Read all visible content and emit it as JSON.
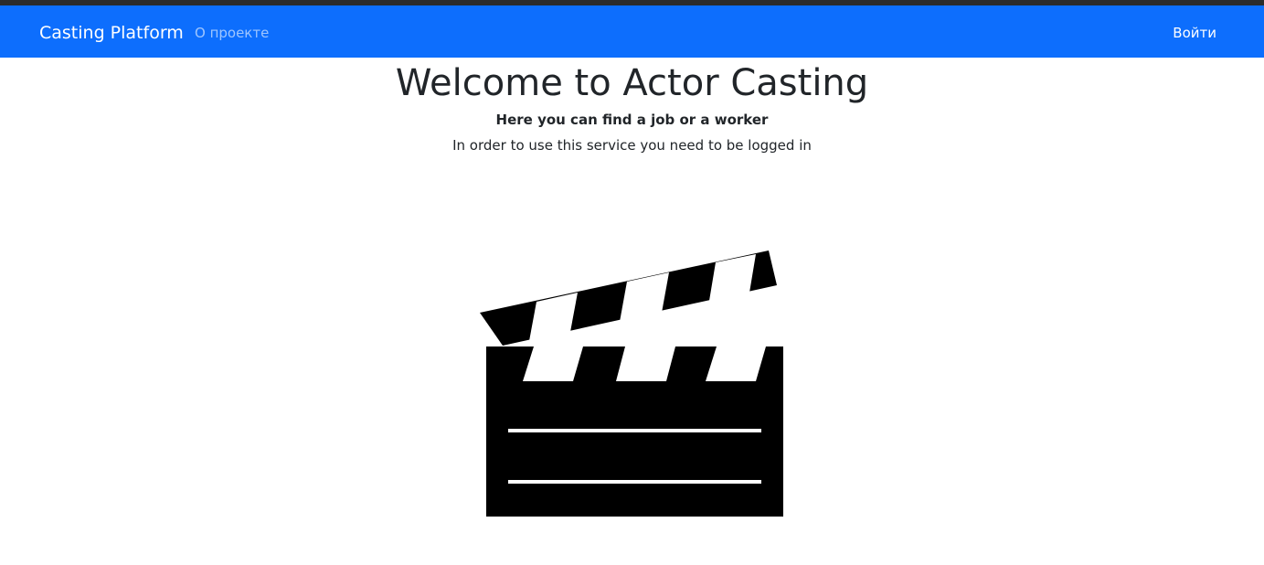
{
  "navbar": {
    "brand": "Casting Platform",
    "about_link": "О проекте",
    "login_link": "Войти",
    "color": "#0d6efd"
  },
  "hero": {
    "title": "Welcome to Actor Casting",
    "subtitle": "Here you can find a job or a worker",
    "note": "In order to use this service you need to be logged in"
  },
  "illustration": {
    "icon": "clapperboard-icon"
  }
}
